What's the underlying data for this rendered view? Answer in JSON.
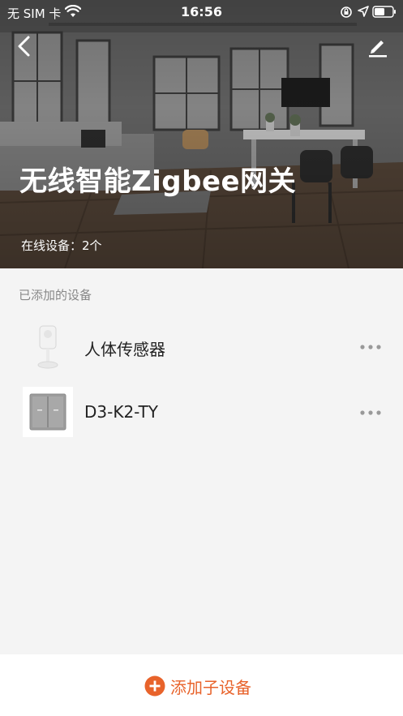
{
  "status_bar": {
    "carrier": "无 SIM 卡",
    "time": "16:56",
    "icons": [
      "wifi-icon",
      "rotation-lock-icon",
      "location-arrow-icon",
      "battery-icon"
    ]
  },
  "header": {
    "title": "无线智能Zigbee网关",
    "online_label": "在线设备：2个",
    "back_icon": "chevron-left-icon",
    "edit_icon": "pencil-icon"
  },
  "devices": {
    "section_label": "已添加的设备",
    "items": [
      {
        "name": "人体传感器",
        "icon": "motion-sensor-icon",
        "more_icon": "more-dots-icon"
      },
      {
        "name": "D3-K2-TY",
        "icon": "wall-switch-icon",
        "more_icon": "more-dots-icon"
      }
    ]
  },
  "footer": {
    "add_label": "添加子设备",
    "add_icon": "plus-circle-icon"
  },
  "colors": {
    "accent": "#e8632b",
    "text_primary": "#222222",
    "text_secondary": "#888888",
    "background": "#f4f4f4"
  }
}
